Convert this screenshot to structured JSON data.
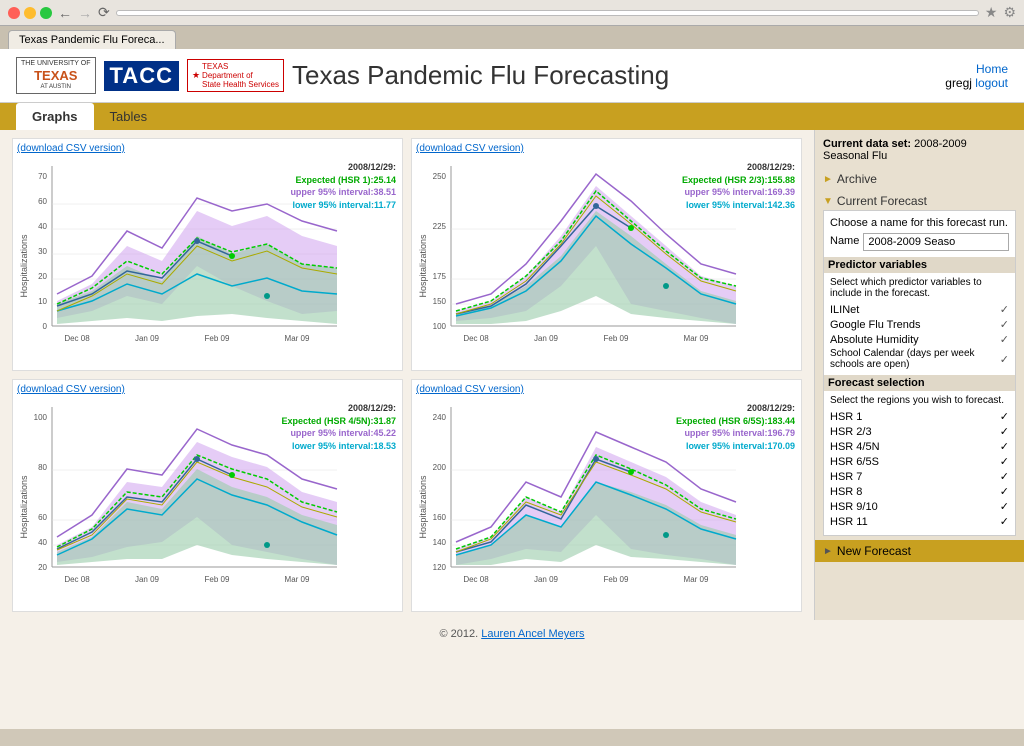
{
  "browser": {
    "tab_title": "Texas Pandemic Flu Foreca...",
    "address": ""
  },
  "header": {
    "site_title": "Texas Pandemic Flu Forecasting",
    "home_link": "Home",
    "user": "gregj",
    "logout_link": "logout"
  },
  "nav": {
    "tabs": [
      {
        "label": "Graphs",
        "active": true
      },
      {
        "label": "Tables",
        "active": false
      }
    ]
  },
  "sidebar": {
    "current_dataset_label": "Current data set:",
    "current_dataset_value": "2008-2009",
    "dataset_subtitle": "Seasonal Flu",
    "archive_label": "Archive",
    "current_forecast_label": "Current Forecast",
    "forecast_name_prompt": "Choose a name for this forecast run.",
    "forecast_name_label": "Name",
    "forecast_name_value": "2008-2009 Seaso",
    "predictor_variables_title": "Predictor variables",
    "predictor_intro": "Select which predictor variables to include in the forecast.",
    "predictors": [
      {
        "label": "ILINet",
        "checked": true
      },
      {
        "label": "Google Flu Trends",
        "checked": true
      },
      {
        "label": "Absolute Humidity",
        "checked": true
      },
      {
        "label": "School Calendar (days per week schools are open)",
        "checked": true
      }
    ],
    "forecast_selection_title": "Forecast selection",
    "forecast_selection_intro": "Select the regions you wish to forecast.",
    "regions": [
      {
        "label": "HSR 1",
        "checked": true
      },
      {
        "label": "HSR 2/3",
        "checked": true
      },
      {
        "label": "HSR 4/5N",
        "checked": true
      },
      {
        "label": "HSR 6/5S",
        "checked": true
      },
      {
        "label": "HSR 7",
        "checked": true
      },
      {
        "label": "HSR 8",
        "checked": true
      },
      {
        "label": "HSR 9/10",
        "checked": true
      },
      {
        "label": "HSR 11",
        "checked": true
      }
    ],
    "new_forecast_label": "New Forecast"
  },
  "charts": [
    {
      "id": "hsr1",
      "download_label": "(download CSV version)",
      "legend_date": "2008/12/29:",
      "legend_expected": "Expected (HSR 1):25.14",
      "legend_upper": "upper 95% interval:38.51",
      "legend_lower": "lower 95% interval:11.77",
      "y_label": "Hospitalizations",
      "y_max": 70,
      "y_min": 0,
      "x_labels": [
        "Dec 08",
        "Jan 09",
        "Feb 09",
        "Mar 09"
      ]
    },
    {
      "id": "hsr23",
      "download_label": "(download CSV version)",
      "legend_date": "2008/12/29:",
      "legend_expected": "Expected (HSR 2/3):155.88",
      "legend_upper": "upper 95% interval:169.39",
      "legend_lower": "lower 95% interval:142.36",
      "y_label": "Hospitalizations",
      "y_max": 250,
      "y_min": 100,
      "x_labels": [
        "Dec 08",
        "Jan 09",
        "Feb 09",
        "Mar 09"
      ]
    },
    {
      "id": "hsr45n",
      "download_label": "(download CSV version)",
      "legend_date": "2008/12/29:",
      "legend_expected": "Expected (HSR 4/5N):31.87",
      "legend_upper": "upper 95% interval:45.22",
      "legend_lower": "lower 95% interval:18.53",
      "y_label": "Hospitalizations",
      "y_max": 100,
      "y_min": 20,
      "x_labels": [
        "Dec 08",
        "Jan 09",
        "Feb 09",
        "Mar 09"
      ]
    },
    {
      "id": "hsr65s",
      "download_label": "(download CSV version)",
      "legend_date": "2008/12/29:",
      "legend_expected": "Expected (HSR 6/5S):183.44",
      "legend_upper": "upper 95% interval:196.79",
      "legend_lower": "lower 95% interval:170.09",
      "y_label": "Hospitalizations",
      "y_max": 240,
      "y_min": 120,
      "x_labels": [
        "Dec 08",
        "Jan 09",
        "Feb 09",
        "Mar 09"
      ]
    }
  ],
  "footer": {
    "copyright": "© 2012.",
    "author_link": "Lauren Ancel Meyers",
    "author_url": "#"
  }
}
